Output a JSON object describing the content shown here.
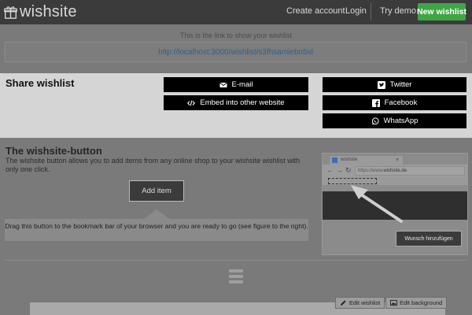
{
  "navbar": {
    "brand": "wishsite",
    "links": [
      {
        "label": "Create account"
      },
      {
        "label": "Login"
      },
      {
        "label": "Try demo"
      }
    ],
    "cta_label": "New wishlist",
    "cta_color": "#3fa645"
  },
  "link_section": {
    "caption": "This is the link to show your wishlist",
    "url": "http://localhost:3000/wishlist/s3fhsamiebn5sl"
  },
  "share": {
    "title": "Share wishlist",
    "buttons": [
      {
        "label": "E-mail",
        "icon": "envelope-icon"
      },
      {
        "label": "Embed into other website",
        "icon": "code-icon"
      },
      {
        "label": "Twitter",
        "icon": "twitter-icon"
      },
      {
        "label": "Facebook",
        "icon": "facebook-icon"
      },
      {
        "label": "WhatsApp",
        "icon": "whatsapp-icon"
      }
    ]
  },
  "wishsite_button": {
    "title": "The wishsite-button",
    "description": "The wishsite button allows you to add items from any online shop to your wishsite wishlist with only one click.",
    "add_item_label": "Add item",
    "drag_hint": "Drag this button to the bookmark bar of your browser and you are ready to go (see figure to the right)."
  },
  "illustration": {
    "tab_title": "wishsite",
    "tab_close": "×",
    "url_prefix": "https://www.",
    "url_host": "wishsite.de",
    "button_label": "Wunsch hinzufügen"
  },
  "bottom": {
    "edit_wishlist": "Edit wishlist",
    "edit_background": "Edit background"
  }
}
